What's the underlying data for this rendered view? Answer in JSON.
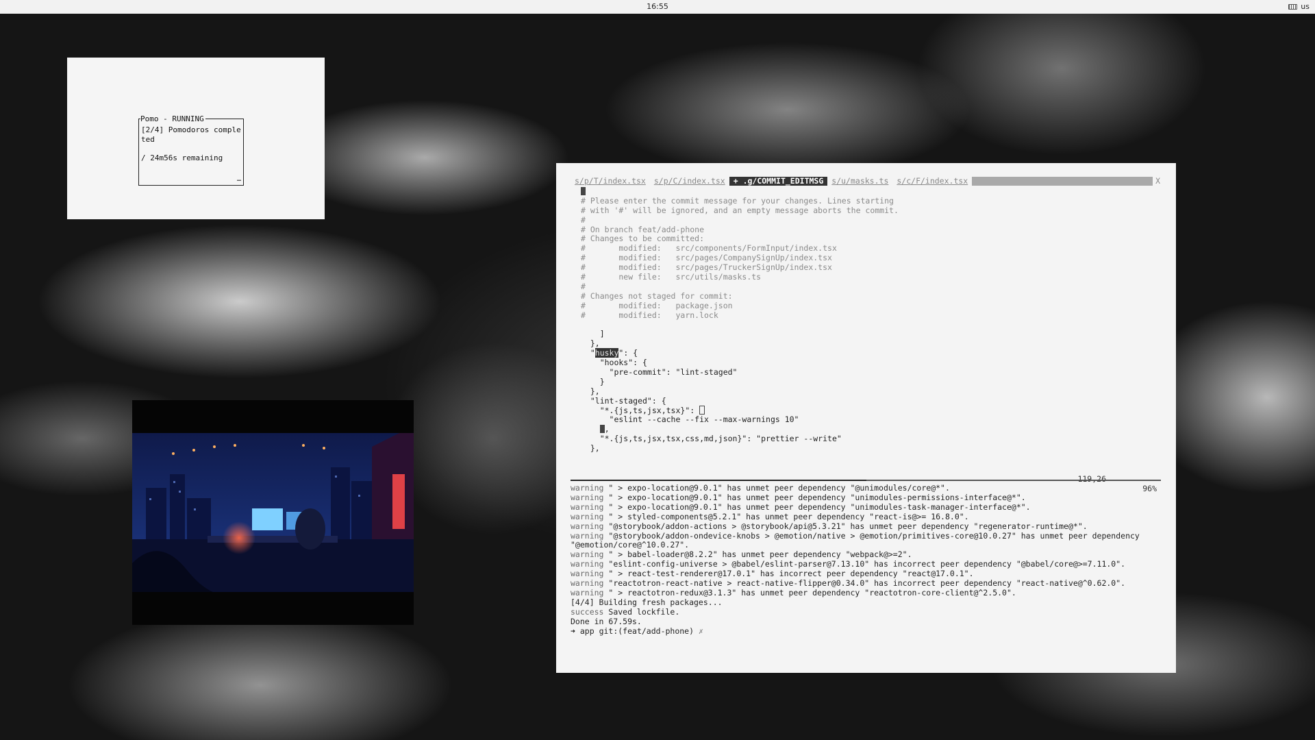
{
  "topbar": {
    "time": "16:55",
    "keyboard_layout": "us",
    "keyboard_icon": "keyboard-icon"
  },
  "pomo": {
    "title": "Pomo - RUNNING",
    "status": "[2/4] Pomodoros completed",
    "remaining": "/ 24m56s remaining",
    "more": "…",
    "completed": 2,
    "total": 4
  },
  "editor": {
    "tabs": [
      {
        "label": "s/p/T/index.tsx",
        "active": false
      },
      {
        "label": "s/p/C/index.tsx",
        "active": false
      },
      {
        "label": "+ .g/COMMIT_EDITMSG",
        "active": true
      },
      {
        "label": "s/u/masks.ts",
        "active": false
      },
      {
        "label": "s/c/F/index.tsx",
        "active": false
      }
    ],
    "close_label": "X",
    "commit_lines": [
      "# Please enter the commit message for your changes. Lines starting",
      "# with '#' will be ignored, and an empty message aborts the commit.",
      "#",
      "# On branch feat/add-phone",
      "# Changes to be committed:",
      "#       modified:   src/components/FormInput/index.tsx",
      "#       modified:   src/pages/CompanySignUp/index.tsx",
      "#       modified:   src/pages/TruckerSignUp/index.tsx",
      "#       new file:   src/utils/masks.ts",
      "#",
      "# Changes not staged for commit:",
      "#       modified:   package.json",
      "#       modified:   yarn.lock"
    ],
    "code": {
      "l1": "    ]",
      "l2": "  },",
      "husky_key": "husky",
      "l3_rest": "\": {",
      "hooks_line": "    \"hooks\": {",
      "precommit_line": "      \"pre-commit\": \"lint-staged\"",
      "l5": "    }",
      "l6": "  },",
      "lintstaged_line": "  \"lint-staged\": {",
      "glob1": "    \"*.{js,ts,jsx,tsx}\": ",
      "eslint_line": "      \"eslint --cache --fix --max-warnings 10\"",
      "l9_rest": ",",
      "glob2_line": "    \"*.{js,ts,jsx,tsx,css,md,json}\": \"prettier --write\"",
      "l11": "  },"
    },
    "position": "119,26",
    "percent": "96%"
  },
  "shell": {
    "lines": [
      {
        "tag": "warning",
        "text": " \" > expo-location@9.0.1\" has unmet peer dependency \"@unimodules/core@*\"."
      },
      {
        "tag": "warning",
        "text": " \" > expo-location@9.0.1\" has unmet peer dependency \"unimodules-permissions-interface@*\"."
      },
      {
        "tag": "warning",
        "text": " \" > expo-location@9.0.1\" has unmet peer dependency \"unimodules-task-manager-interface@*\"."
      },
      {
        "tag": "warning",
        "text": " \" > styled-components@5.2.1\" has unmet peer dependency \"react-is@>= 16.8.0\"."
      },
      {
        "tag": "warning",
        "text": " \"@storybook/addon-actions > @storybook/api@5.3.21\" has unmet peer dependency \"regenerator-runtime@*\"."
      },
      {
        "tag": "warning",
        "text": " \"@storybook/addon-ondevice-knobs > @emotion/native > @emotion/primitives-core@10.0.27\" has unmet peer dependency \"@emotion/core@^10.0.27\"."
      },
      {
        "tag": "warning",
        "text": " \" > babel-loader@8.2.2\" has unmet peer dependency \"webpack@>=2\"."
      },
      {
        "tag": "warning",
        "text": " \"eslint-config-universe > @babel/eslint-parser@7.13.10\" has incorrect peer dependency \"@babel/core@>=7.11.0\"."
      },
      {
        "tag": "warning",
        "text": " \" > react-test-renderer@17.0.1\" has incorrect peer dependency \"react@17.0.1\"."
      },
      {
        "tag": "warning",
        "text": " \"reactotron-react-native > react-native-flipper@0.34.0\" has incorrect peer dependency \"react-native@^0.62.0\"."
      },
      {
        "tag": "warning",
        "text": " \" > reactotron-redux@3.1.3\" has unmet peer dependency \"reactotron-core-client@^2.5.0\"."
      },
      {
        "tag": "",
        "text": "[4/4] Building fresh packages..."
      },
      {
        "tag": "success",
        "text": " Saved lockfile."
      },
      {
        "tag": "",
        "text": "Done in 67.59s."
      }
    ],
    "prompt_dir": " app ",
    "prompt_git": "git:(feat/add-phone)",
    "prompt_dirty": " ✗"
  }
}
